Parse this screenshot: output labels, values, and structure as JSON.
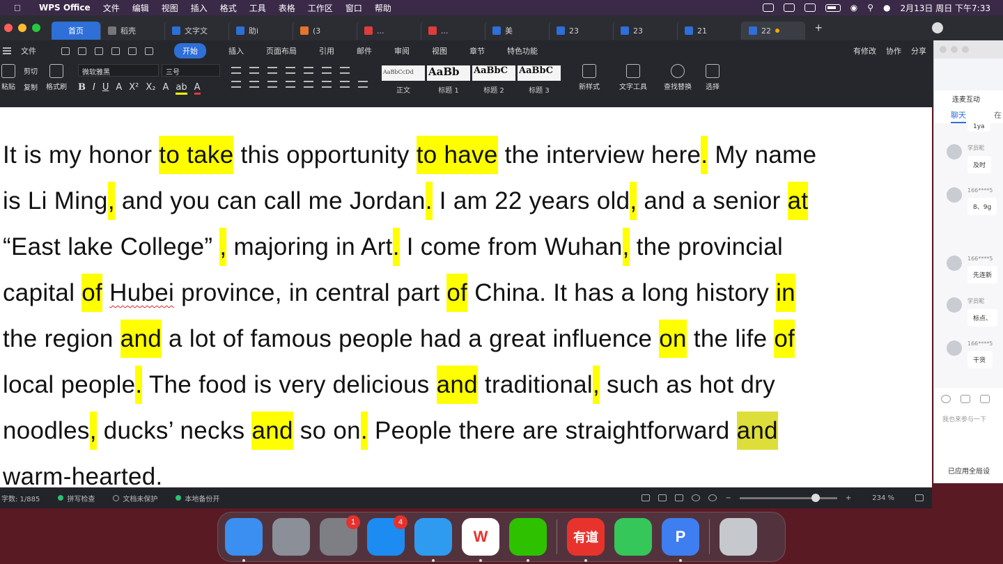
{
  "menubar": {
    "app": "WPS Office",
    "items": [
      "文件",
      "编辑",
      "视图",
      "插入",
      "格式",
      "工具",
      "表格",
      "工作区",
      "窗口",
      "帮助"
    ],
    "clock": "2月13日 周日 下午7:33"
  },
  "tabs": {
    "home": "首页",
    "docs": [
      "稻壳",
      "文字文",
      "助i",
      "(3",
      "...",
      "...",
      "美",
      "23",
      "23",
      "21",
      "22"
    ]
  },
  "ribbon": {
    "file": "文件",
    "tabs": [
      "开始",
      "插入",
      "页面布局",
      "引用",
      "邮件",
      "审阅",
      "视图",
      "章节",
      "特色功能"
    ],
    "right": [
      "有修改",
      "协作",
      "分享"
    ],
    "tools": {
      "paste": "粘贴",
      "cut": "剪切",
      "copy": "复制",
      "format_painter": "格式刷",
      "font_name": "微软雅黑",
      "font_size": "三号",
      "new_style": "新样式",
      "text_tools": "文字工具",
      "find_replace": "查找替换",
      "select": "选择"
    },
    "styles": [
      {
        "preview": "AaBbCcDd",
        "name": "正文"
      },
      {
        "preview": "AaBb",
        "name": "标题 1"
      },
      {
        "preview": "AaBbC",
        "name": "标题 2"
      },
      {
        "preview": "AaBbC",
        "name": "标题 3"
      }
    ]
  },
  "document": {
    "lines": [
      [
        [
          "It is my honor ",
          0
        ],
        [
          "to take",
          1
        ],
        [
          " this opportunity ",
          0
        ],
        [
          "to have",
          1
        ],
        [
          " the interview here",
          0
        ],
        [
          ".",
          1
        ],
        [
          " My name",
          0
        ]
      ],
      [
        [
          "is Li Ming",
          0
        ],
        [
          ",",
          1
        ],
        [
          " and you can call me Jordan",
          0
        ],
        [
          ".",
          1
        ],
        [
          " I am 22 years old",
          0
        ],
        [
          ",",
          1
        ],
        [
          " and a senior ",
          0
        ],
        [
          "at",
          1
        ]
      ],
      [
        [
          " “East lake College” ",
          0
        ],
        [
          ",",
          1
        ],
        [
          " majoring in Art",
          0
        ],
        [
          ".",
          1
        ],
        [
          " I come from Wuhan",
          0
        ],
        [
          ",",
          1
        ],
        [
          " the provincial",
          0
        ]
      ],
      [
        [
          "capital ",
          0
        ],
        [
          "of",
          1
        ],
        [
          " ",
          0
        ],
        [
          "Hubei",
          3
        ],
        [
          " province, in   central part ",
          0
        ],
        [
          "of",
          1
        ],
        [
          " China. It has a long history ",
          0
        ],
        [
          "in",
          1
        ]
      ],
      [
        [
          "the region ",
          0
        ],
        [
          "and",
          1
        ],
        [
          " a lot of famous people had a great influence ",
          0
        ],
        [
          "on",
          1
        ],
        [
          " the life ",
          0
        ],
        [
          "of",
          1
        ]
      ],
      [
        [
          "local people",
          0
        ],
        [
          ".",
          1
        ],
        [
          " The food is very delicious ",
          0
        ],
        [
          "and",
          1
        ],
        [
          " traditional",
          0
        ],
        [
          ",",
          1
        ],
        [
          " such as hot dry",
          0
        ]
      ],
      [
        [
          "noodles",
          0
        ],
        [
          ",",
          1
        ],
        [
          " ducks’   necks ",
          0
        ],
        [
          "and",
          1
        ],
        [
          " so on",
          0
        ],
        [
          ".",
          1
        ],
        [
          " People there are straightforward ",
          0
        ],
        [
          "and",
          2
        ]
      ],
      [
        [
          "warm-hearted.",
          0
        ]
      ]
    ]
  },
  "status": {
    "word_count": "字数: 1/885",
    "spell_check": "拼写检查",
    "doc_protect": "文档未保护",
    "backup": "本地备份开",
    "zoom": "234 %",
    "zoom_level": 0.78
  },
  "chat": {
    "title": "连麦互动",
    "tabs": [
      "聊天",
      "在"
    ],
    "messages": [
      {
        "name": "",
        "text": "1ya"
      },
      {
        "name": "学员昵",
        "text": "及时"
      },
      {
        "name": "166****5",
        "text": "8、9g"
      },
      {
        "name": "166****5",
        "text": "先连新"
      },
      {
        "name": "学员昵",
        "text": "标点、"
      },
      {
        "name": "166****5",
        "text": "干货"
      }
    ],
    "input_placeholder": "我也来参与一下",
    "footer": "已应用全局设"
  },
  "dock": {
    "apps": [
      {
        "icon": "finder-icon",
        "label": "",
        "color": "#3b8ff0",
        "badge": "",
        "running": true
      },
      {
        "icon": "launchpad-icon",
        "label": "",
        "color": "#8a8f98",
        "badge": "",
        "running": false
      },
      {
        "icon": "system-preferences-icon",
        "label": "",
        "color": "#7d7f85",
        "badge": "1",
        "running": false
      },
      {
        "icon": "app-store-icon",
        "label": "",
        "color": "#1d8cf2",
        "badge": "4",
        "running": false
      },
      {
        "icon": "safari-icon",
        "label": "",
        "color": "#2f9bf0",
        "badge": "",
        "running": true
      },
      {
        "icon": "wps-icon",
        "label": "W",
        "color": "#ffffff",
        "badge": "",
        "running": true
      },
      {
        "icon": "wechat-icon",
        "label": "",
        "color": "#2dc100",
        "badge": "",
        "running": true
      },
      {
        "icon": "youdao-icon",
        "label": "有道",
        "color": "#e8332c",
        "badge": "",
        "running": true
      },
      {
        "icon": "facetime-icon",
        "label": "",
        "color": "#35c759",
        "badge": "",
        "running": false
      },
      {
        "icon": "pdf-icon",
        "label": "P",
        "color": "#3e7ef0",
        "badge": "",
        "running": true
      },
      {
        "icon": "trash-icon",
        "label": "",
        "color": "#c5c8cc",
        "badge": "",
        "running": false
      }
    ]
  },
  "colors": {
    "highlight": "#ffff00",
    "highlight_dim": "#dede3a",
    "accent": "#2e6fd8"
  }
}
